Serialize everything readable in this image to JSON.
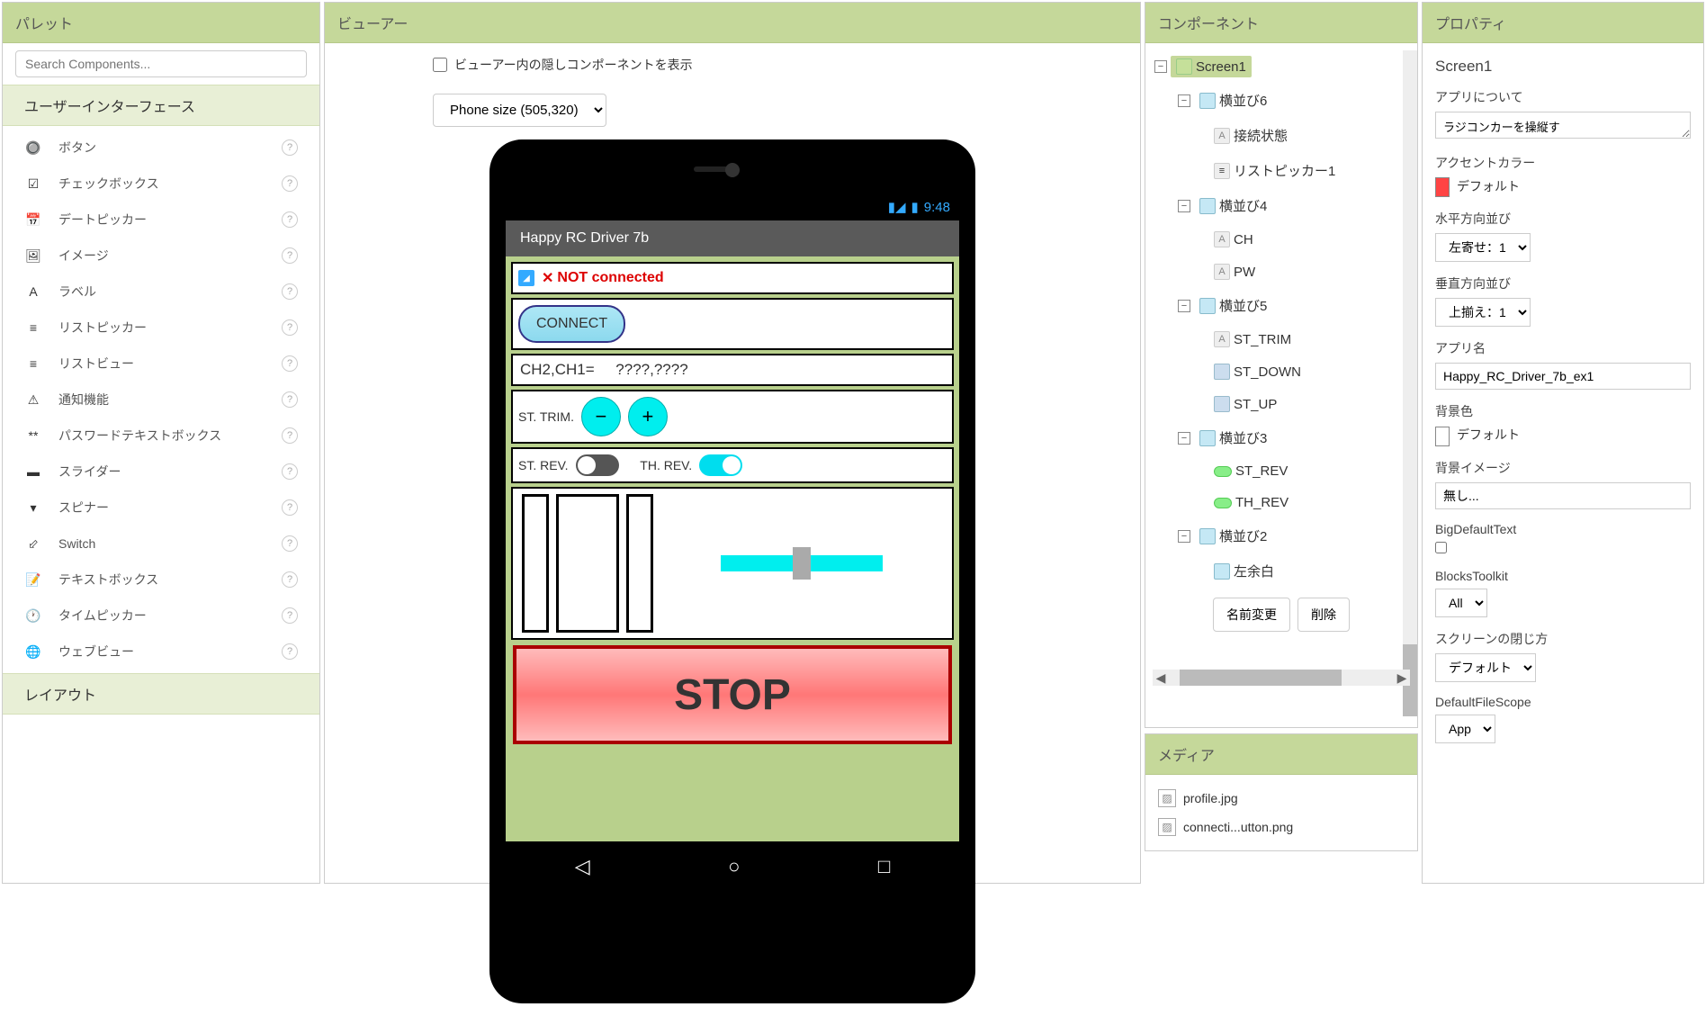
{
  "palette": {
    "title": "パレット",
    "search_placeholder": "Search Components...",
    "cat_ui": "ユーザーインターフェース",
    "cat_layout": "レイアウト",
    "items": [
      {
        "icon": "🔘",
        "label": "ボタン"
      },
      {
        "icon": "☑",
        "label": "チェックボックス"
      },
      {
        "icon": "📅",
        "label": "デートピッカー"
      },
      {
        "icon": "🖼",
        "label": "イメージ"
      },
      {
        "icon": "A",
        "label": "ラベル"
      },
      {
        "icon": "≡",
        "label": "リストピッカー"
      },
      {
        "icon": "≡",
        "label": "リストビュー"
      },
      {
        "icon": "⚠",
        "label": "通知機能"
      },
      {
        "icon": "**",
        "label": "パスワードテキストボックス"
      },
      {
        "icon": "▬",
        "label": "スライダー"
      },
      {
        "icon": "▾",
        "label": "スピナー"
      },
      {
        "icon": "⬃",
        "label": "Switch"
      },
      {
        "icon": "📝",
        "label": "テキストボックス"
      },
      {
        "icon": "🕐",
        "label": "タイムピッカー"
      },
      {
        "icon": "🌐",
        "label": "ウェブビュー"
      }
    ]
  },
  "viewer": {
    "title": "ビューアー",
    "show_hidden": "ビューアー内の隠しコンポーネントを表示",
    "phone_size": "Phone size (505,320)",
    "status_time": "9:48",
    "app_title": "Happy RC Driver 7b",
    "conn_x": "✕",
    "conn_status": "NOT connected",
    "connect": "CONNECT",
    "ch_label": "CH2,CH1=",
    "ch_val": "????,????",
    "st_trim": "ST. TRIM.",
    "minus": "−",
    "plus": "+",
    "st_rev": "ST. REV.",
    "th_rev": "TH. REV.",
    "stop": "STOP"
  },
  "components": {
    "title": "コンポーネント",
    "rename": "名前変更",
    "delete": "削除",
    "tree": {
      "screen": "Screen1",
      "h6": "横並び6",
      "conn_state": "接続状態",
      "listpicker1": "リストピッカー1",
      "h4": "横並び4",
      "ch": "CH",
      "pw": "PW",
      "h5": "横並び5",
      "st_trim": "ST_TRIM",
      "st_down": "ST_DOWN",
      "st_up": "ST_UP",
      "h3": "横並び3",
      "st_rev": "ST_REV",
      "th_rev": "TH_REV",
      "h2": "横並び2",
      "left_margin": "左余白"
    }
  },
  "media": {
    "title": "メディア",
    "items": [
      "profile.jpg",
      "connecti...utton.png"
    ]
  },
  "properties": {
    "title": "プロパティ",
    "selected": "Screen1",
    "about_label": "アプリについて",
    "about_value": "ラジコンカーを操縦す",
    "accent_label": "アクセントカラー",
    "accent_value": "デフォルト",
    "halign_label": "水平方向並び",
    "halign_value": "左寄せ：1",
    "valign_label": "垂直方向並び",
    "valign_value": "上揃え：1",
    "appname_label": "アプリ名",
    "appname_value": "Happy_RC_Driver_7b_ex1",
    "bgcolor_label": "背景色",
    "bgcolor_value": "デフォルト",
    "bgimage_label": "背景イメージ",
    "bgimage_value": "無し...",
    "bigtext_label": "BigDefaultText",
    "blocks_label": "BlocksToolkit",
    "blocks_value": "All",
    "close_label": "スクリーンの閉じ方",
    "close_value": "デフォルト",
    "scope_label": "DefaultFileScope",
    "scope_value": "App"
  }
}
